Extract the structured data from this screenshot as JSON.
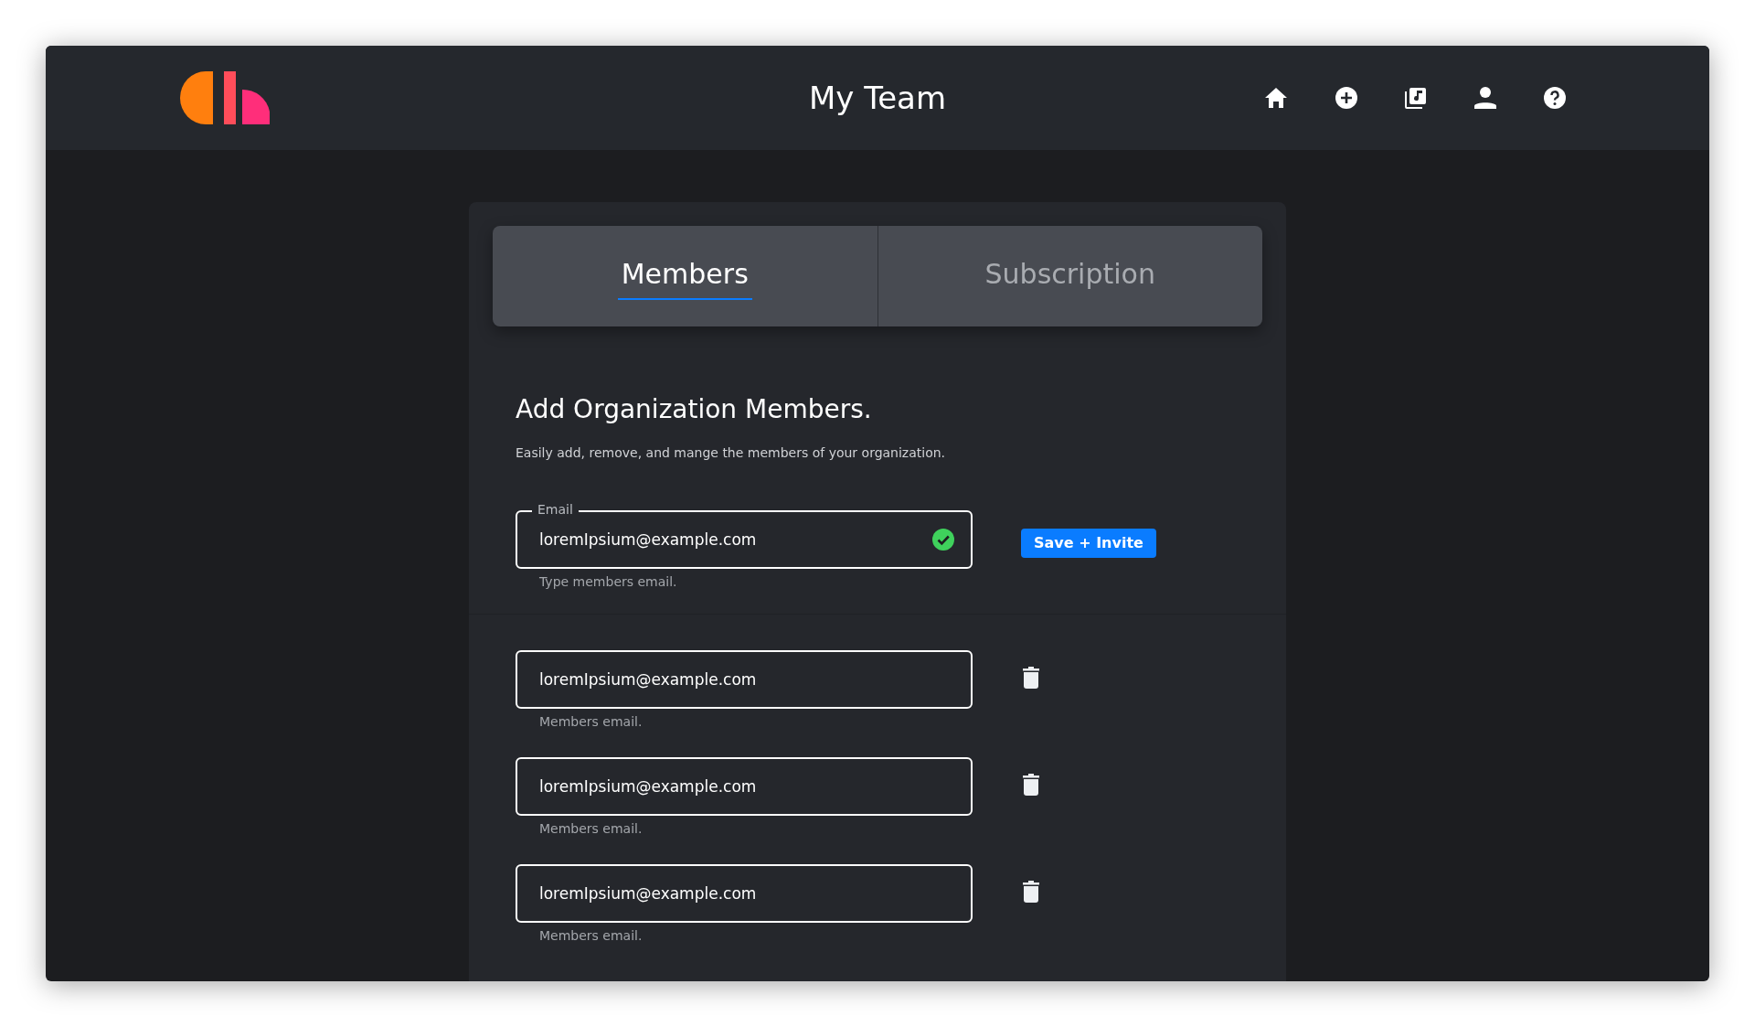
{
  "header": {
    "title": "My Team"
  },
  "tabs": [
    {
      "label": "Members",
      "selected": true
    },
    {
      "label": "Subscription",
      "selected": false
    }
  ],
  "section": {
    "heading": "Add Organization Members.",
    "description": "Easily add, remove, and mange the members of your organization."
  },
  "invite": {
    "label": "Email",
    "value": "loremIpsium@example.com",
    "valid": true,
    "helper": "Type members email.",
    "button": "Save + Invite"
  },
  "members": [
    {
      "value": "loremIpsium@example.com",
      "helper": "Members email."
    },
    {
      "value": "loremIpsium@example.com",
      "helper": "Members email."
    },
    {
      "value": "loremIpsium@example.com",
      "helper": "Members email."
    }
  ]
}
